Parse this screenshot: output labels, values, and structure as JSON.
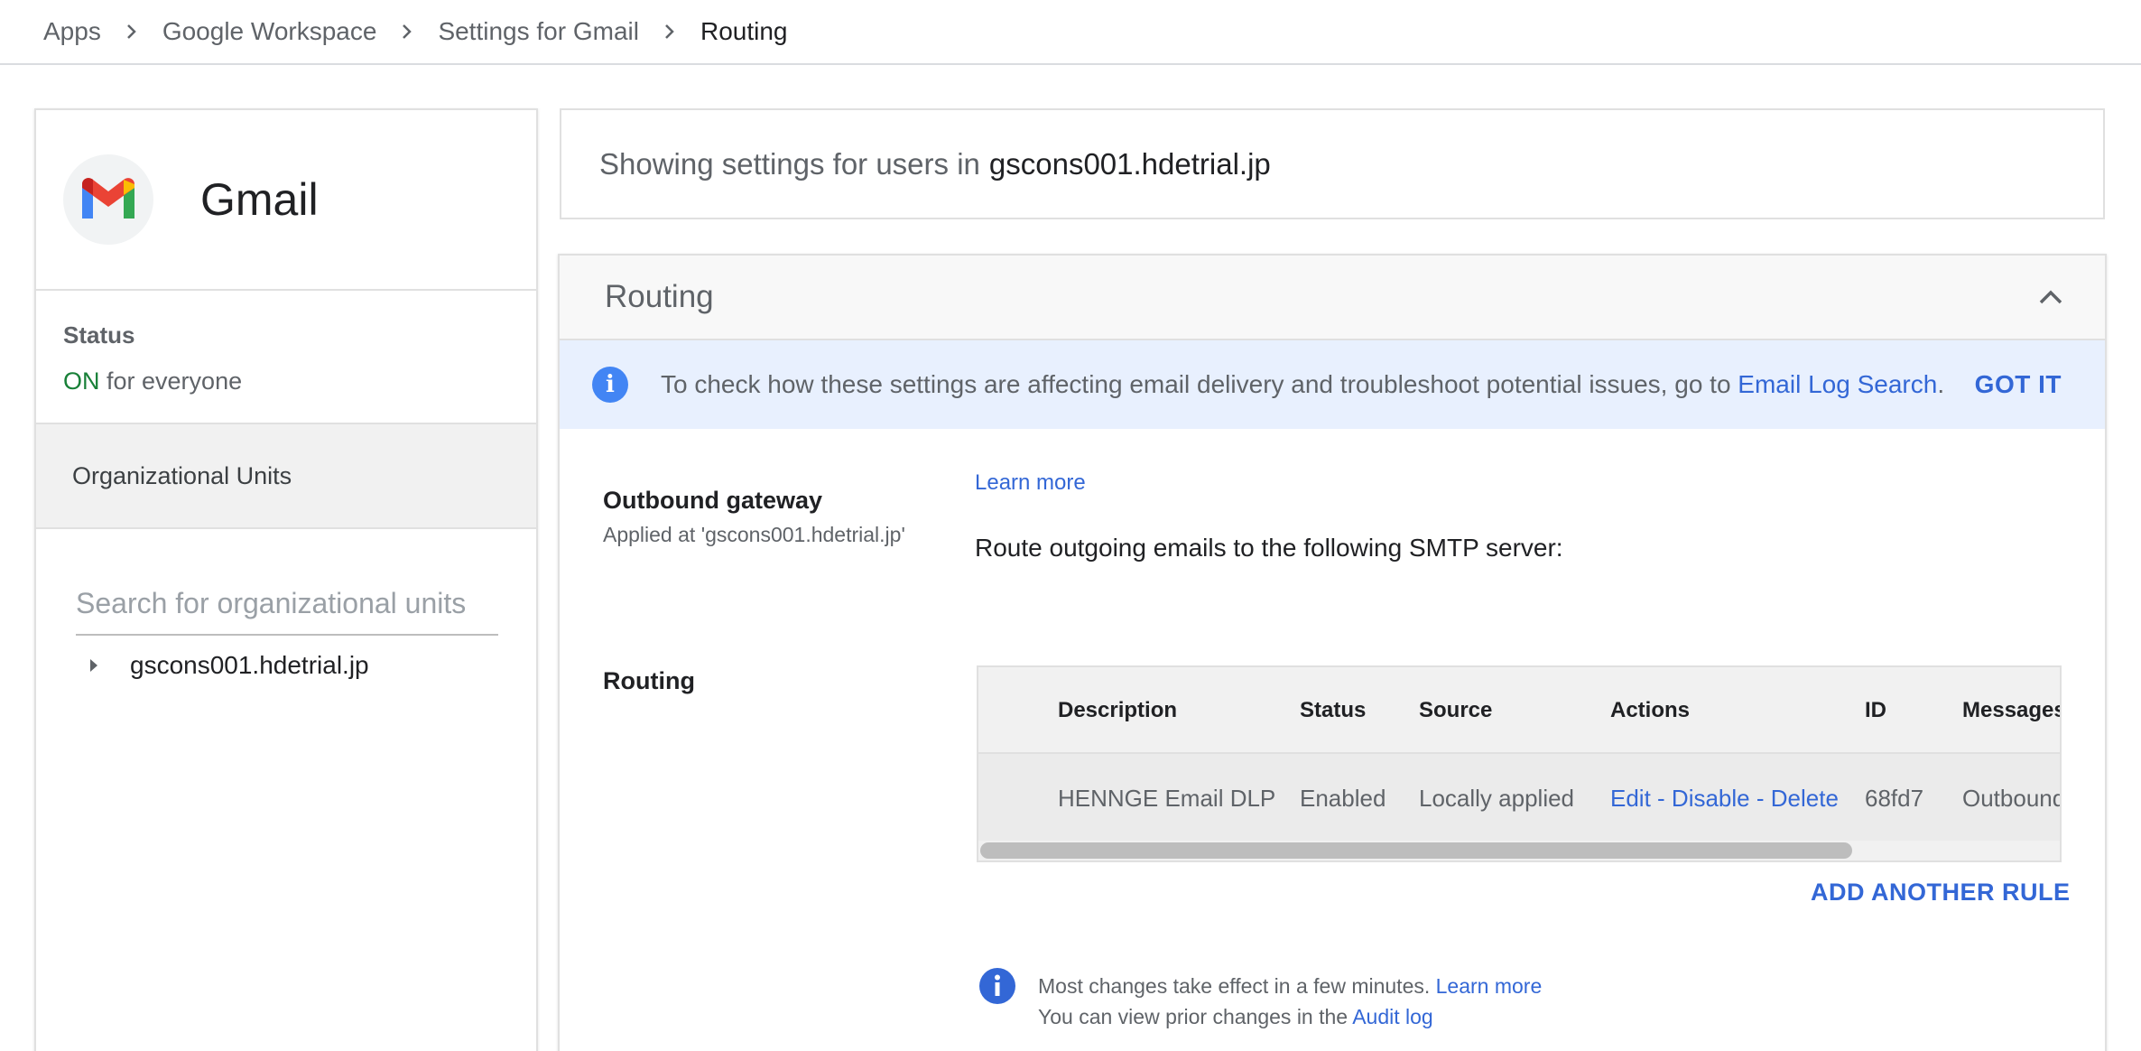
{
  "breadcrumb": {
    "items": [
      "Apps",
      "Google Workspace",
      "Settings for Gmail"
    ],
    "current": "Routing"
  },
  "app": {
    "name": "Gmail",
    "status_title": "Status",
    "status_value": "ON",
    "status_suffix": "for everyone",
    "ou_header": "Organizational Units",
    "ou_search_placeholder": "Search for organizational units",
    "ou_root": "gscons001.hdetrial.jp"
  },
  "showing": {
    "prefix": "Showing settings for users in",
    "domain": "gscons001.hdetrial.jp"
  },
  "routing_card": {
    "title": "Routing",
    "banner_text": "To check how these settings are affecting email delivery and troubleshoot potential issues, go to",
    "banner_link": "Email Log Search",
    "banner_period": ".",
    "banner_button": "GOT IT",
    "outbound": {
      "label": "Outbound gateway",
      "applied": "Applied at 'gscons001.hdetrial.jp'",
      "learn_more": "Learn more",
      "description": "Route outgoing emails to the following SMTP server:"
    },
    "routing": {
      "label": "Routing",
      "columns": [
        "Description",
        "Status",
        "Source",
        "Actions",
        "ID",
        "Messages"
      ],
      "rows": [
        {
          "description": "HENNGE Email DLP",
          "status": "Enabled",
          "source": "Locally applied",
          "actions": [
            "Edit",
            "Disable",
            "Delete"
          ],
          "action_sep": " - ",
          "id": "68fd7",
          "messages": "Outbound"
        }
      ],
      "add_rule": "ADD ANOTHER RULE"
    },
    "footer": {
      "line1": "Most changes take effect in a few minutes.",
      "line1_link": "Learn more",
      "line2": "You can view prior changes in the",
      "line2_link": "Audit log"
    }
  },
  "colors": {
    "accent": "#3367d6",
    "on_green": "#188038",
    "banner_bg": "#e8f0fe"
  }
}
